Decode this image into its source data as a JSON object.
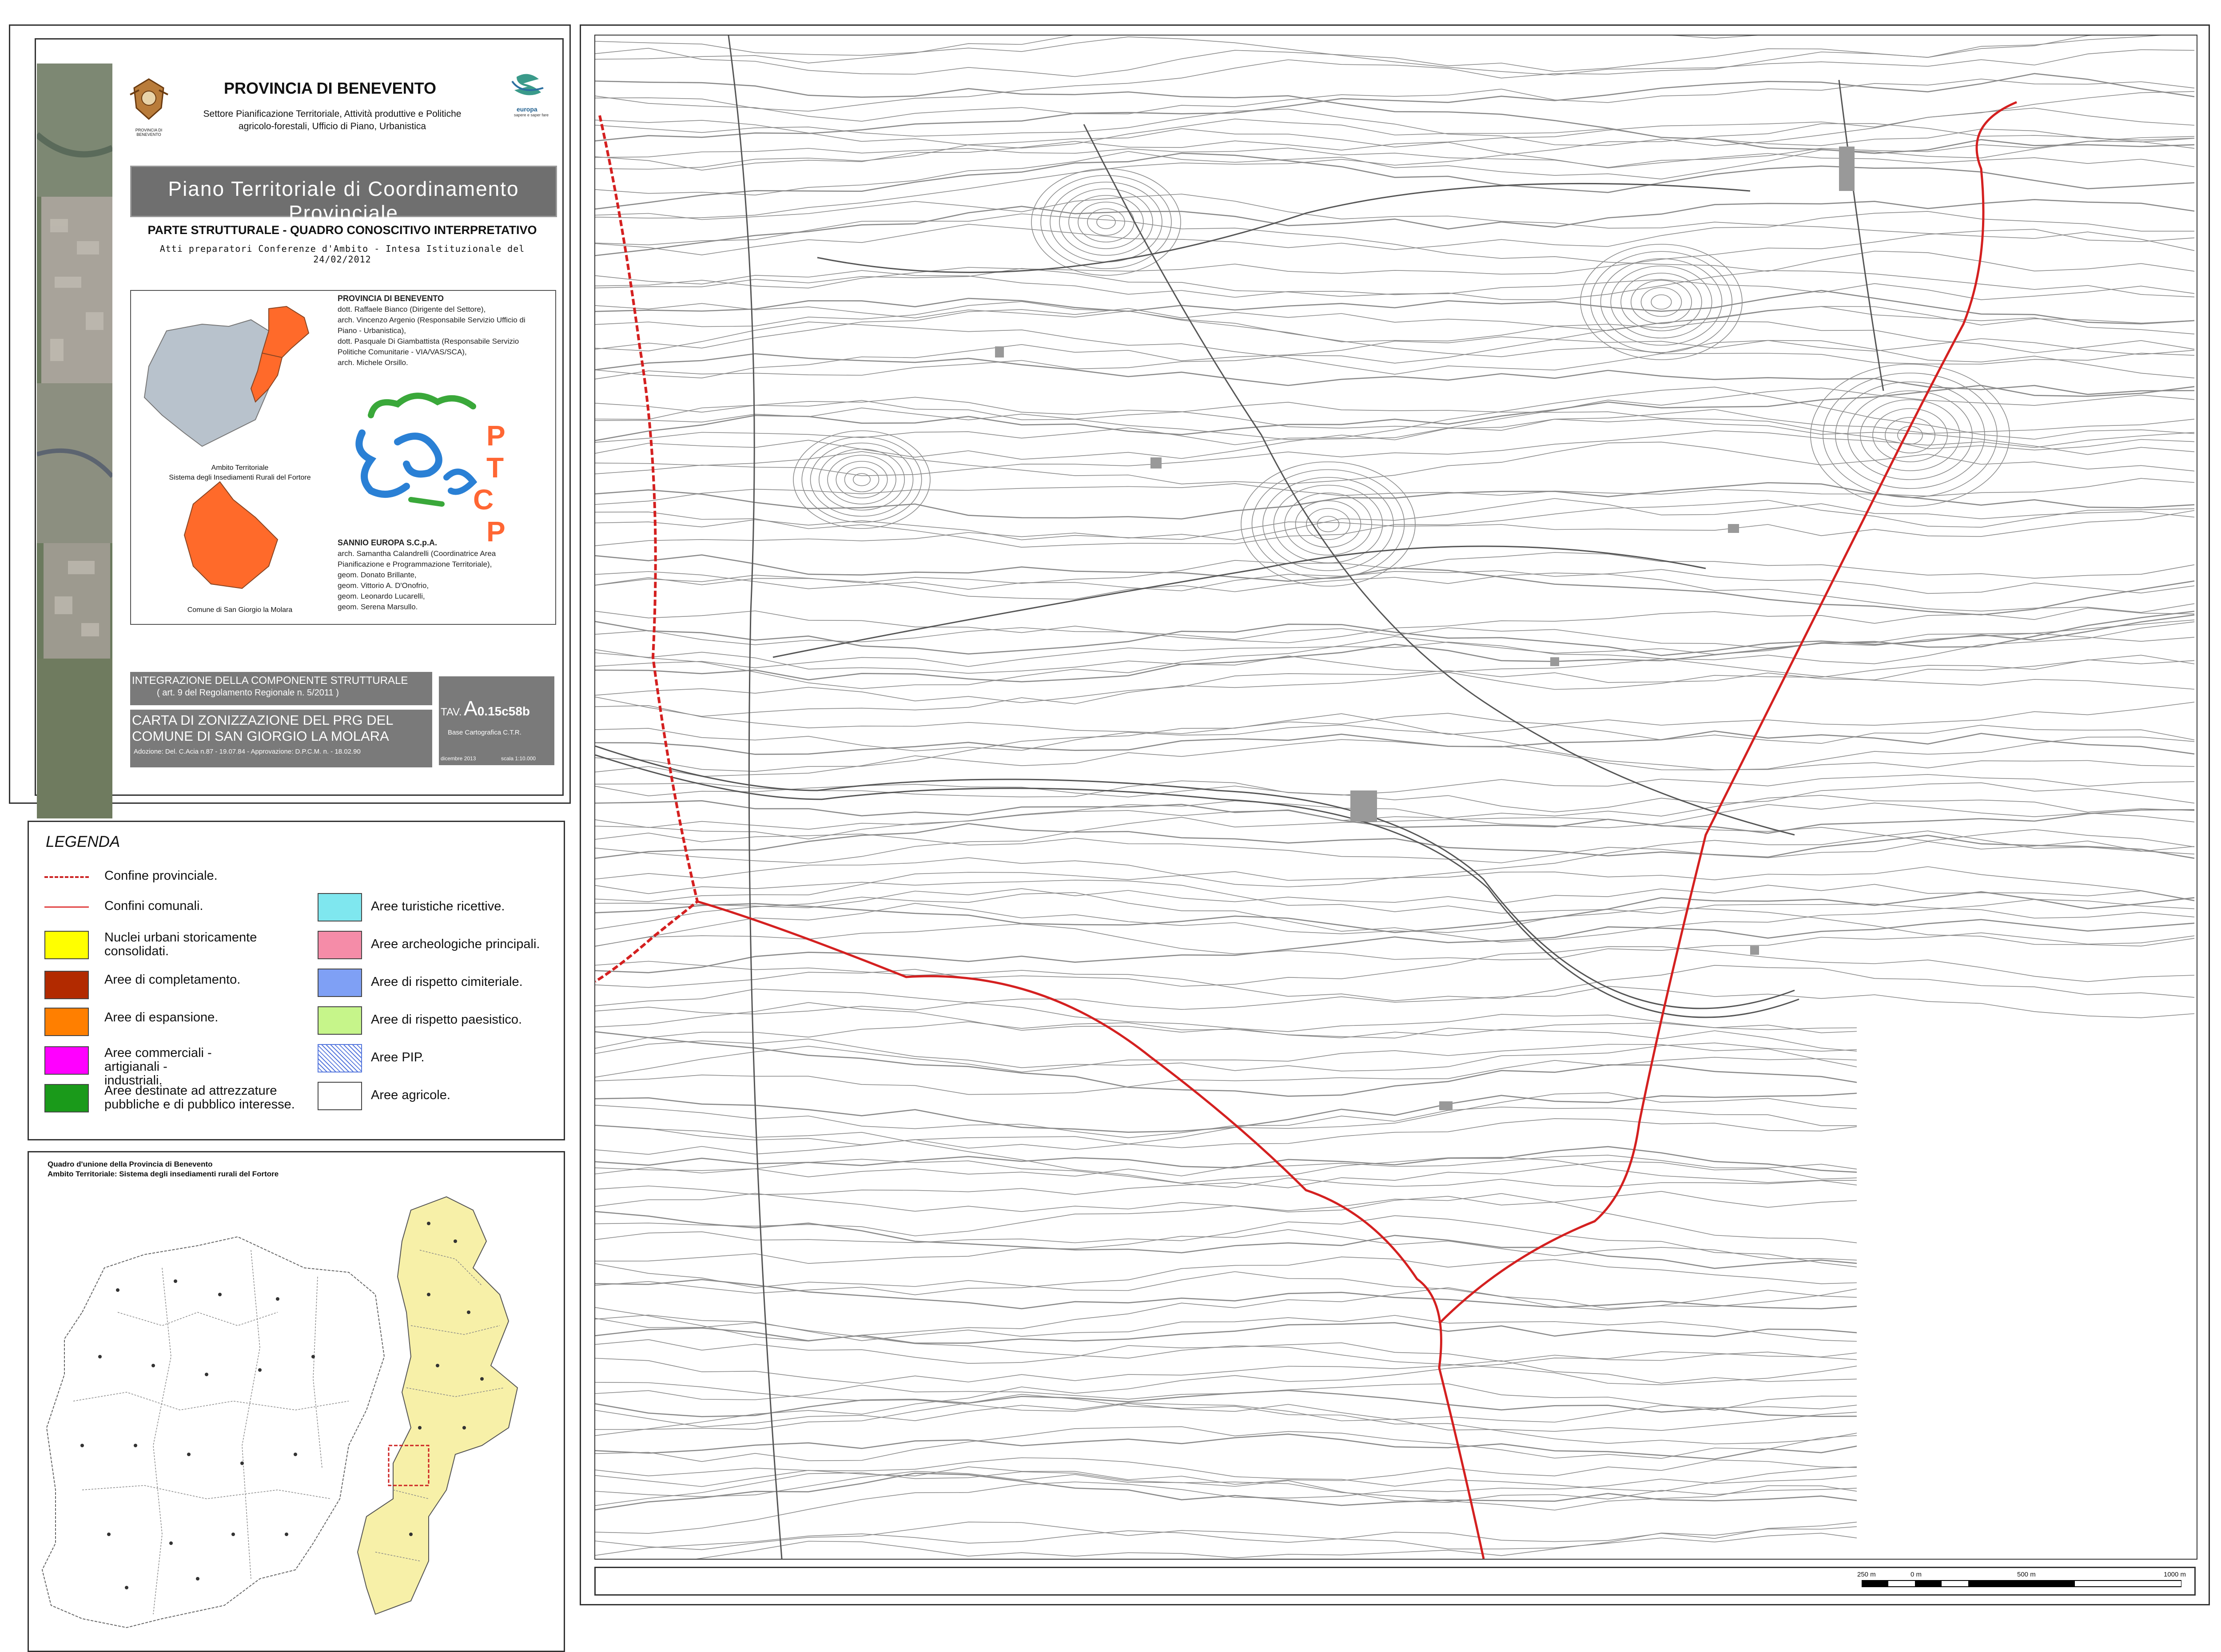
{
  "header": {
    "province": "PROVINCIA DI BENEVENTO",
    "sector_lines": [
      "Settore Pianificazione Territoriale, Attività produttive e Politiche",
      "agricolo-forestali, Ufficio di Piano, Urbanistica"
    ],
    "emblem_caption": "PROVINCIA DI BENEVENTO",
    "logo_text": "europa",
    "logo_sub": "sapere e saper fare"
  },
  "plan_title": "Piano Territoriale di Coordinamento Provinciale",
  "section": {
    "heading": "PARTE STRUTTURALE - QUADRO CONOSCITIVO INTERPRETATIVO",
    "subheading": "Atti preparatori Conferenze d'Ambito - Intesa Istituzionale del 24/02/2012"
  },
  "credits": {
    "province_title": "PROVINCIA DI BENEVENTO",
    "province_lines": [
      "dott. Raffaele Bianco (Dirigente del Settore),",
      "arch. Vincenzo Argenio (Responsabile Servizio Ufficio di",
      "Piano - Urbanistica),",
      "dott. Pasquale Di Giambattista (Responsabile Servizio",
      "Politiche Comunitarie - VIA/VAS/SCA),",
      "arch. Michele Orsillo."
    ],
    "sannio_title": "SANNIO EUROPA S.C.p.A.",
    "sannio_lines": [
      "arch. Samantha Calandrelli (Coordinatrice Area",
      "Pianificazione e Programmazione Territoriale),",
      "geom. Donato Brillante,",
      "geom. Vittorio A. D'Onofrio,",
      "geom. Leonardo Lucarelli,",
      "geom. Serena Marsullo."
    ],
    "ambito_caption": [
      "Ambito Territoriale",
      "Sistema degli Insediamenti Rurali del Fortore"
    ],
    "comune_caption": "Comune di San Giorgio la Molara",
    "ptcp_letters": [
      "P",
      "T",
      "C",
      "P"
    ]
  },
  "tavola": {
    "integration_title": "INTEGRAZIONE DELLA COMPONENTE STRUTTURALE",
    "integration_sub": "( art. 9 del Regolamento Regionale n. 5/2011 )",
    "map_title_1": "CARTA DI ZONIZZAZIONE DEL PRG DEL",
    "map_title_2": "COMUNE DI SAN GIORGIO LA MOLARA",
    "adoption": "Adozione: Del. C.Acia n.87 - 19.07.84 - Approvazione: D.P.C.M. n. - 18.02.90",
    "tav_prefix": "TAV.",
    "tav_code_big": "A",
    "tav_code_rest": "0.15c58b",
    "base": "Base Cartografica C.T.R.",
    "date": "dicembre 2013",
    "scale": "scala 1:10.000"
  },
  "legend": {
    "title": "LEGENDA",
    "left_items": [
      {
        "label": "Confine provinciale.",
        "kind": "dashed",
        "color": "#cc2222"
      },
      {
        "label": "Confini comunali.",
        "kind": "line",
        "color": "#e04040"
      },
      {
        "label": "Nuclei urbani storicamente consolidati.",
        "kind": "fill",
        "color": "#ffff00"
      },
      {
        "label": "Aree di completamento.",
        "kind": "fill",
        "color": "#b22a00"
      },
      {
        "label": "Aree di espansione.",
        "kind": "fill",
        "color": "#ff7f00"
      },
      {
        "label": "Aree commerciali - artigianali - industriali.",
        "kind": "fill",
        "color": "#ff00ff"
      },
      {
        "label": "Aree destinate ad attrezzature pubbliche e di pubblico interesse.",
        "kind": "fill",
        "color": "#1a9a1a"
      }
    ],
    "right_items": [
      {
        "label": "Aree turistiche ricettive.",
        "kind": "fill",
        "color": "#7fe7ef"
      },
      {
        "label": "Aree archeologiche principali.",
        "kind": "fill",
        "color": "#f58ca8"
      },
      {
        "label": "Aree di rispetto cimiteriale.",
        "kind": "fill",
        "color": "#7fa0f5"
      },
      {
        "label": "Aree di rispetto paesistico.",
        "kind": "fill",
        "color": "#c6f58a"
      },
      {
        "label": "Aree PIP.",
        "kind": "hatch",
        "color": "#5577dd"
      },
      {
        "label": "Aree agricole.",
        "kind": "fill",
        "color": "#ffffff"
      }
    ]
  },
  "locator": {
    "title_1": "Quadro d'unione della Provincia di Benevento",
    "title_2": "Ambito Territoriale: Sistema degli insediamenti rurali del Fortore"
  },
  "scalebar": {
    "labels": [
      "250 m",
      "0 m",
      "500 m",
      "1000 m"
    ]
  }
}
